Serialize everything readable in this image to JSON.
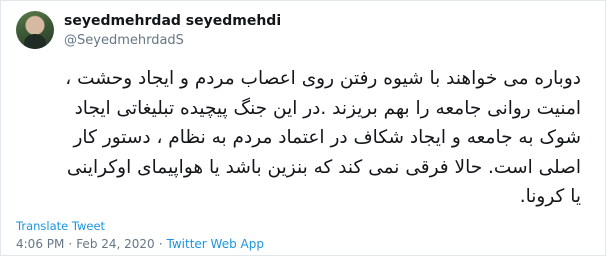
{
  "author": {
    "display_name": "seyedmehrdad seyedmehdi",
    "handle": "@SeyedmehrdadS"
  },
  "tweet": {
    "text": "دوباره می خواهند با شیوه رفتن روی اعصاب مردم و ایجاد وحشت ،\nامنیت روانی جامعه را بهم بریزند .در این جنگ پیچیده تبلیغاتی ایجاد\nشوک به جامعه و ایجاد شکاف در  اعتماد مردم  به نظام ، دستور کار\nاصلی است. حالا فرقی نمی کند که بنزین باشد یا هواپیمای اوکراینی\nیا کرونا."
  },
  "translate_label": "Translate Tweet",
  "meta": {
    "time": "4:06 PM",
    "separator": "·",
    "date": "Feb 24, 2020",
    "source": "Twitter Web App"
  },
  "colors": {
    "link": "#1b95e0",
    "secondary_text": "#657786",
    "border": "#e1e8ed"
  }
}
